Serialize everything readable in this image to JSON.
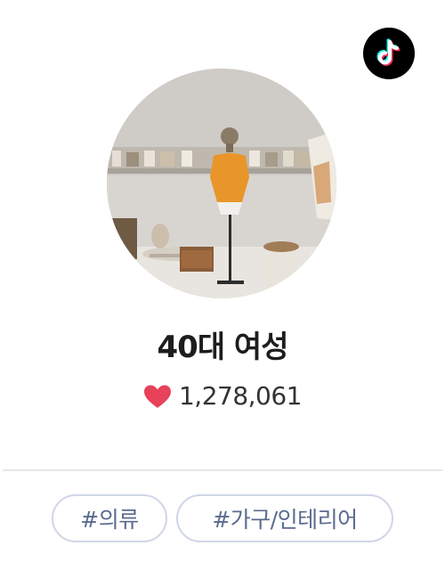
{
  "profile": {
    "name": "40대 여성",
    "likes": "1,278,061"
  },
  "icons": {
    "platform": "tiktok-icon",
    "like": "heart-icon"
  },
  "tags": [
    {
      "label": "#의류"
    },
    {
      "label": "#가구/인테리어"
    }
  ],
  "colors": {
    "heart": "#e8415a",
    "tag_border": "#cfd6e6",
    "tag_text": "#5b6b8f"
  }
}
